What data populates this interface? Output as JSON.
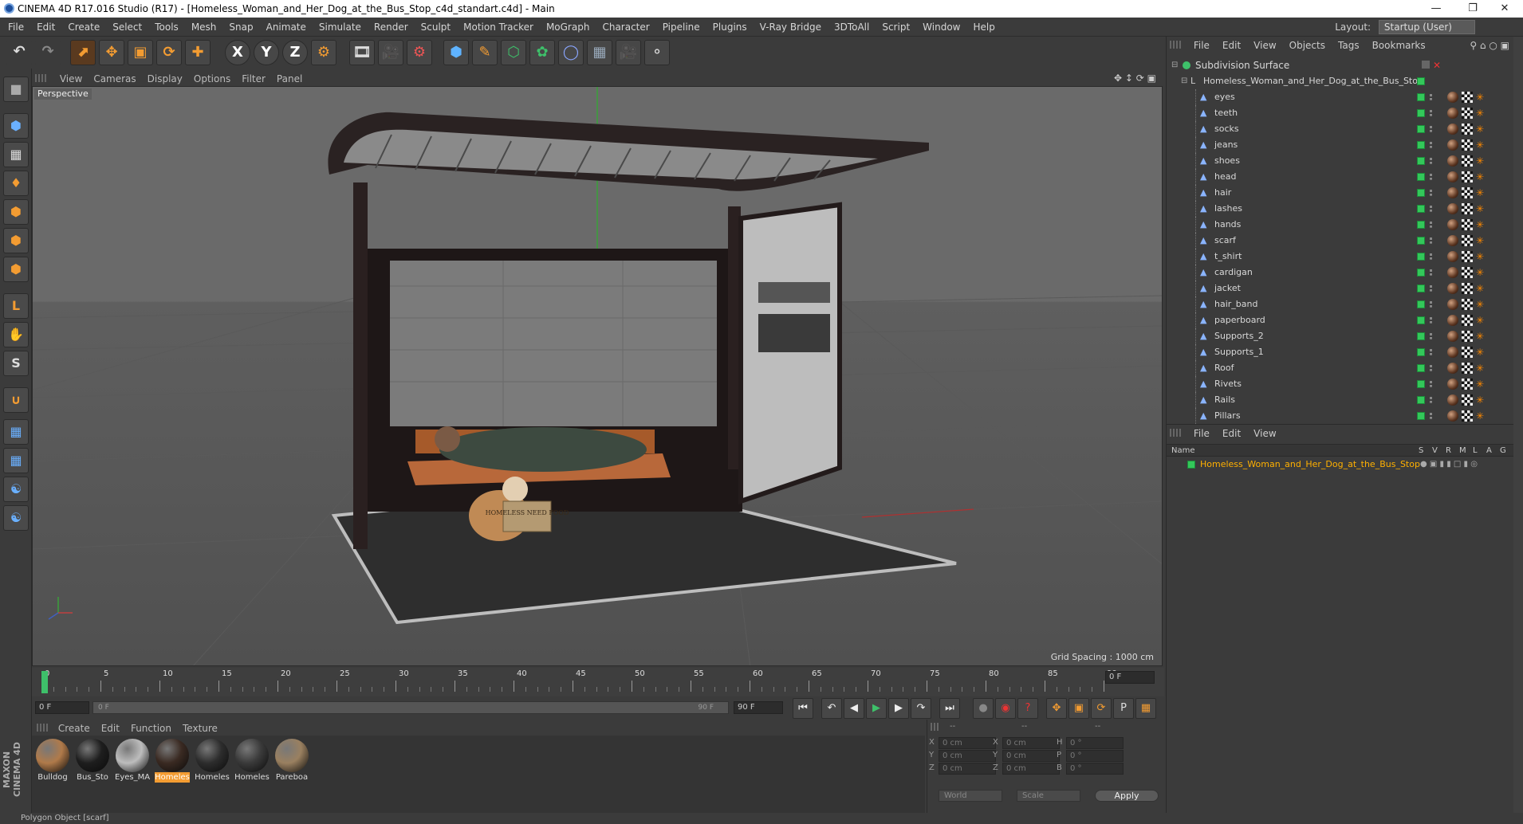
{
  "window": {
    "title": "CINEMA 4D R17.016 Studio (R17) - [Homeless_Woman_and_Her_Dog_at_the_Bus_Stop_c4d_standart.c4d] - Main",
    "min": "—",
    "restore": "❐",
    "close": "✕"
  },
  "menubar": {
    "items": [
      "File",
      "Edit",
      "Create",
      "Select",
      "Tools",
      "Mesh",
      "Snap",
      "Animate",
      "Simulate",
      "Render",
      "Sculpt",
      "Motion Tracker",
      "MoGraph",
      "Character",
      "Pipeline",
      "Plugins",
      "V-Ray Bridge",
      "3DToAll",
      "Script",
      "Window",
      "Help"
    ],
    "layout_label": "Layout:",
    "layout_value": "Startup (User)"
  },
  "toolbar": {
    "icons": [
      "undo-icon",
      "redo-icon",
      "select-arrow-icon",
      "move-icon",
      "scale-icon",
      "rotate-icon",
      "move-plus-icon",
      "x-axis-icon",
      "y-axis-icon",
      "z-axis-icon",
      "world-coords-icon",
      "render-region-icon",
      "render-view-icon",
      "render-settings-icon",
      "cube-icon",
      "pen-icon",
      "subdivision-icon",
      "cloner-icon",
      "deformer-icon",
      "floor-icon",
      "camera-icon",
      "light-icon"
    ],
    "xyz": [
      "X",
      "Y",
      "Z"
    ]
  },
  "viewport": {
    "menu": [
      "View",
      "Cameras",
      "Display",
      "Options",
      "Filter",
      "Panel"
    ],
    "label": "Perspective",
    "grid_spacing": "Grid Spacing : 1000 cm",
    "sign": "HOMELESS NEED FOOD"
  },
  "timeline": {
    "ticks": [
      "0",
      "5",
      "10",
      "15",
      "20",
      "25",
      "30",
      "35",
      "40",
      "45",
      "50",
      "55",
      "60",
      "65",
      "70",
      "75",
      "80",
      "85",
      "90"
    ],
    "current_frame_right": "0 F",
    "start_frame": "0 F",
    "range_start": "0 F",
    "range_end": "90 F",
    "end_frame": "90 F"
  },
  "materials": {
    "menu": [
      "Create",
      "Edit",
      "Function",
      "Texture"
    ],
    "items": [
      {
        "label": "Bulldog",
        "color": "#b07a4a",
        "selected": false
      },
      {
        "label": "Bus_Sto",
        "color": "#1e1e1e",
        "selected": false
      },
      {
        "label": "Eyes_MA",
        "color": "#bdbdbd",
        "selected": false
      },
      {
        "label": "Homeles",
        "color": "#3a2a22",
        "selected": true
      },
      {
        "label": "Homeles",
        "color": "#2d2d2d",
        "selected": false
      },
      {
        "label": "Homeles",
        "color": "#3a3a3a",
        "selected": false
      },
      {
        "label": "Pareboa",
        "color": "#9a8060",
        "selected": false
      }
    ]
  },
  "coords": {
    "dashes": [
      "--",
      "--",
      "--"
    ],
    "rows": [
      {
        "a": "X",
        "av": "0 cm",
        "b": "X",
        "bv": "0 cm",
        "c": "H",
        "cv": "0 °"
      },
      {
        "a": "Y",
        "av": "0 cm",
        "b": "Y",
        "bv": "0 cm",
        "c": "P",
        "cv": "0 °"
      },
      {
        "a": "Z",
        "av": "0 cm",
        "b": "Z",
        "bv": "0 cm",
        "c": "B",
        "cv": "0 °"
      }
    ],
    "world": "World",
    "scale": "Scale",
    "apply": "Apply"
  },
  "object_manager": {
    "menu": [
      "File",
      "Edit",
      "View",
      "Objects",
      "Tags",
      "Bookmarks"
    ],
    "root": "Subdivision Surface",
    "group": "Homeless_Woman_and_Her_Dog_at_the_Bus_Stop",
    "children": [
      "eyes",
      "teeth",
      "socks",
      "jeans",
      "shoes",
      "head",
      "hair",
      "lashes",
      "hands",
      "scarf",
      "t_shirt",
      "cardigan",
      "jacket",
      "hair_band",
      "paperboard",
      "Supports_2",
      "Supports_1",
      "Roof",
      "Rivets",
      "Rails",
      "Pillars"
    ]
  },
  "attribute_manager": {
    "menu": [
      "File",
      "Edit",
      "View"
    ],
    "name_header": "Name",
    "columns": [
      "S",
      "V",
      "R",
      "M",
      "L",
      "A",
      "G"
    ],
    "item": "Homeless_Woman_and_Her_Dog_at_the_Bus_Stop"
  },
  "side_logo": "MAXON CINEMA 4D",
  "status": "Polygon Object [scarf]",
  "colors": {
    "accent": "#f39c32",
    "selected_text": "#ffb000",
    "green_tag": "#33c85a"
  }
}
